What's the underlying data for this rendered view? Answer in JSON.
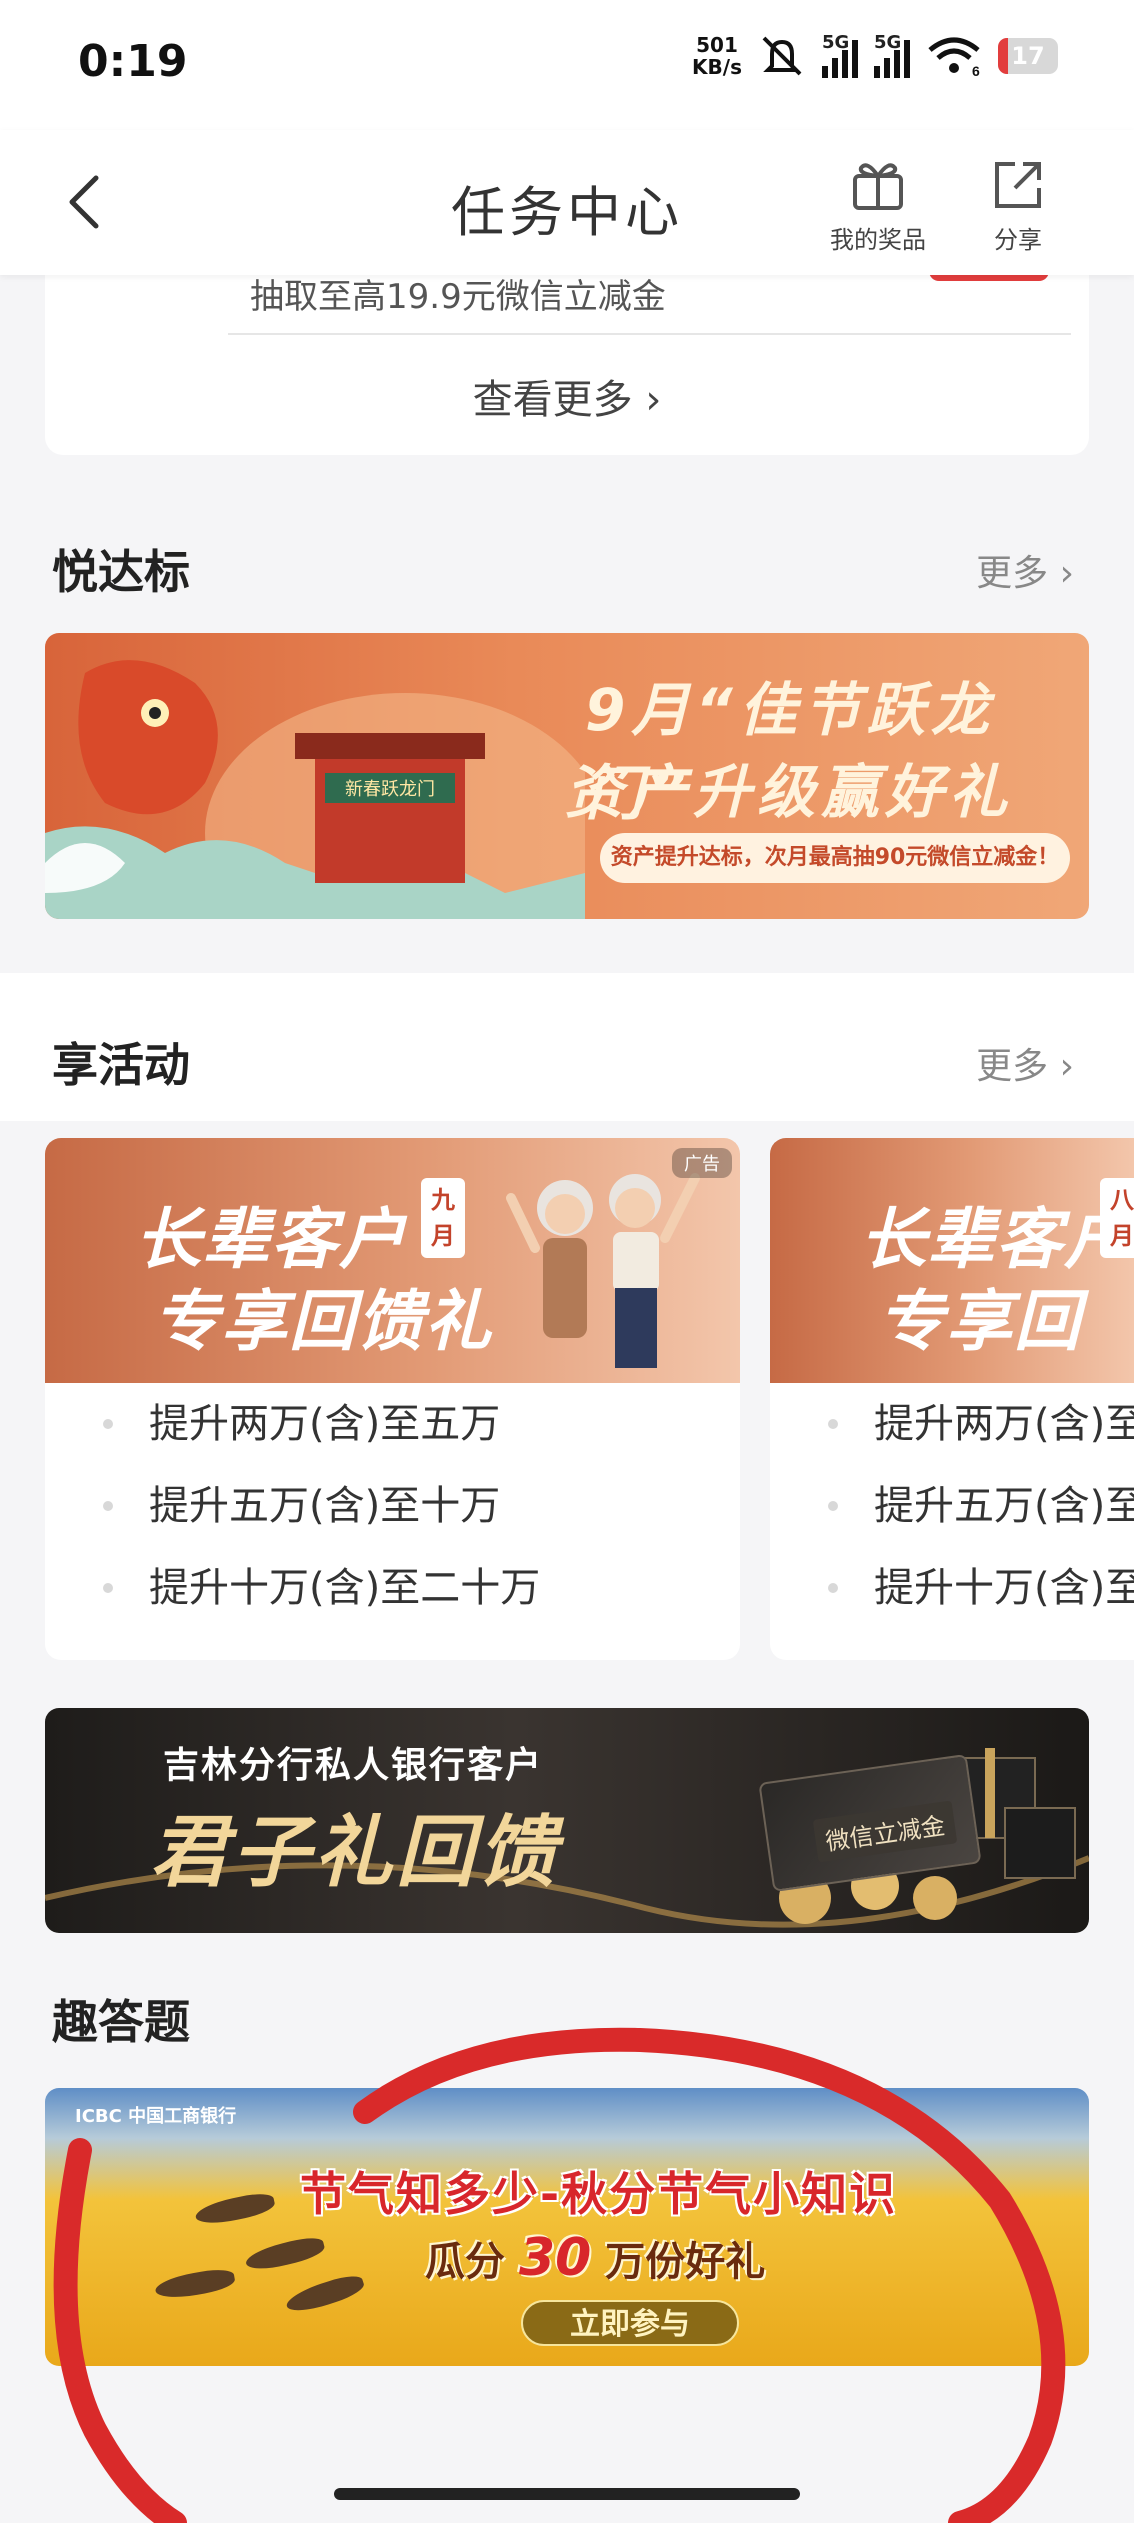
{
  "status_bar": {
    "time": "0:19",
    "net_speed_value": "501",
    "net_speed_unit": "KB/s",
    "signal1_label": "5G",
    "signal2_label": "5G",
    "wifi_label": "6",
    "battery_level": "17",
    "battery_color": "#e23d3d"
  },
  "nav": {
    "title": "任务中心",
    "back_icon": "chevron-left-icon",
    "my_prizes_label": "我的奖品",
    "share_label": "分享"
  },
  "top_card": {
    "clipped_text": "抽取至高19.9元微信立减金",
    "see_more_label": "查看更多"
  },
  "section_yuedabiao": {
    "title": "悦达标",
    "more_label": "更多",
    "banner": {
      "line1": "9月“佳节跃龙门”",
      "line2": "资产升级赢好礼",
      "subtitle": "资产提升达标，次月最高抽90元微信立减金！"
    }
  },
  "section_activities": {
    "title": "享活动",
    "more_label": "更多",
    "cards": [
      {
        "title_line1": "长辈客户",
        "title_line2": "专享回馈礼",
        "month_seal": "九月",
        "ad_tag": "广告",
        "items": [
          "提升两万(含)至五万",
          "提升五万(含)至十万",
          "提升十万(含)至二十万"
        ]
      },
      {
        "title_line1": "长辈客户",
        "title_line2": "专享回馈礼",
        "month_seal": "八月",
        "items": [
          "提升两万(含)至",
          "提升五万(含)至",
          "提升十万(含)至"
        ]
      }
    ]
  },
  "banner_junzili": {
    "line1": "吉林分行私人银行客户",
    "line2": "君子礼回馈",
    "envelope_label": "微信立减金"
  },
  "section_quiz": {
    "title": "趣答题",
    "banner": {
      "logo_text": "ICBC 中国工商银行",
      "line1": "节气知多少-秋分节气小知识",
      "line2_prefix": "瓜分",
      "line2_number": "30",
      "line2_suffix": "万份好礼",
      "button_label": "立即参与"
    }
  },
  "annotation": {
    "circle_color": "#d92a2a"
  }
}
